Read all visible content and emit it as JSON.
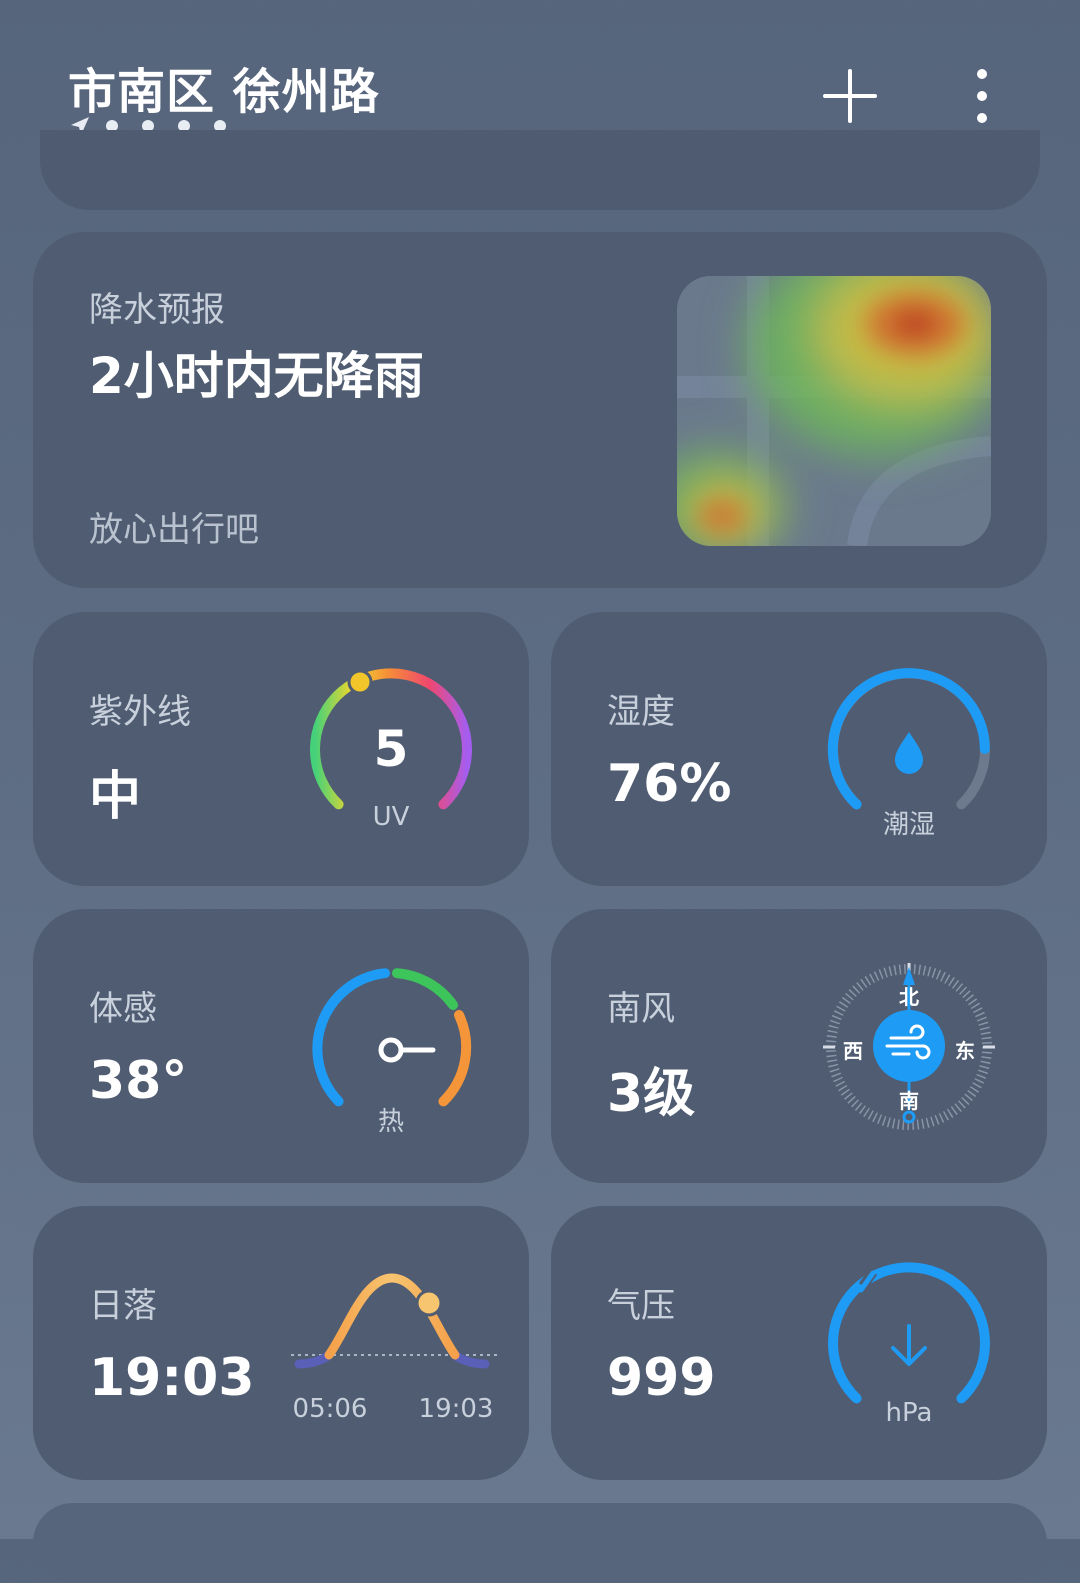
{
  "header": {
    "location": "市南区 徐州路",
    "page_dots": 4
  },
  "rain": {
    "label": "降水预报",
    "title": "2小时内无降雨",
    "subtitle": "放心出行吧"
  },
  "uv": {
    "label": "紫外线",
    "value": "中",
    "index": "5",
    "unit": "UV"
  },
  "humidity": {
    "label": "湿度",
    "value": "76%",
    "level_text": "潮湿",
    "percent": 76
  },
  "feels_like": {
    "label": "体感",
    "value": "38°",
    "level_text": "热"
  },
  "wind": {
    "label": "南风",
    "value": "3级",
    "north": "北",
    "south": "南",
    "west": "西",
    "east": "东"
  },
  "sunset": {
    "label": "日落",
    "value": "19:03",
    "sunrise_time": "05:06",
    "sunset_time": "19:03"
  },
  "pressure": {
    "label": "气压",
    "value": "999",
    "unit": "hPa"
  },
  "colors": {
    "card_bg": "#4f5c71",
    "accent_blue": "#1e9bf5",
    "label_gray": "#c8d0dc"
  }
}
